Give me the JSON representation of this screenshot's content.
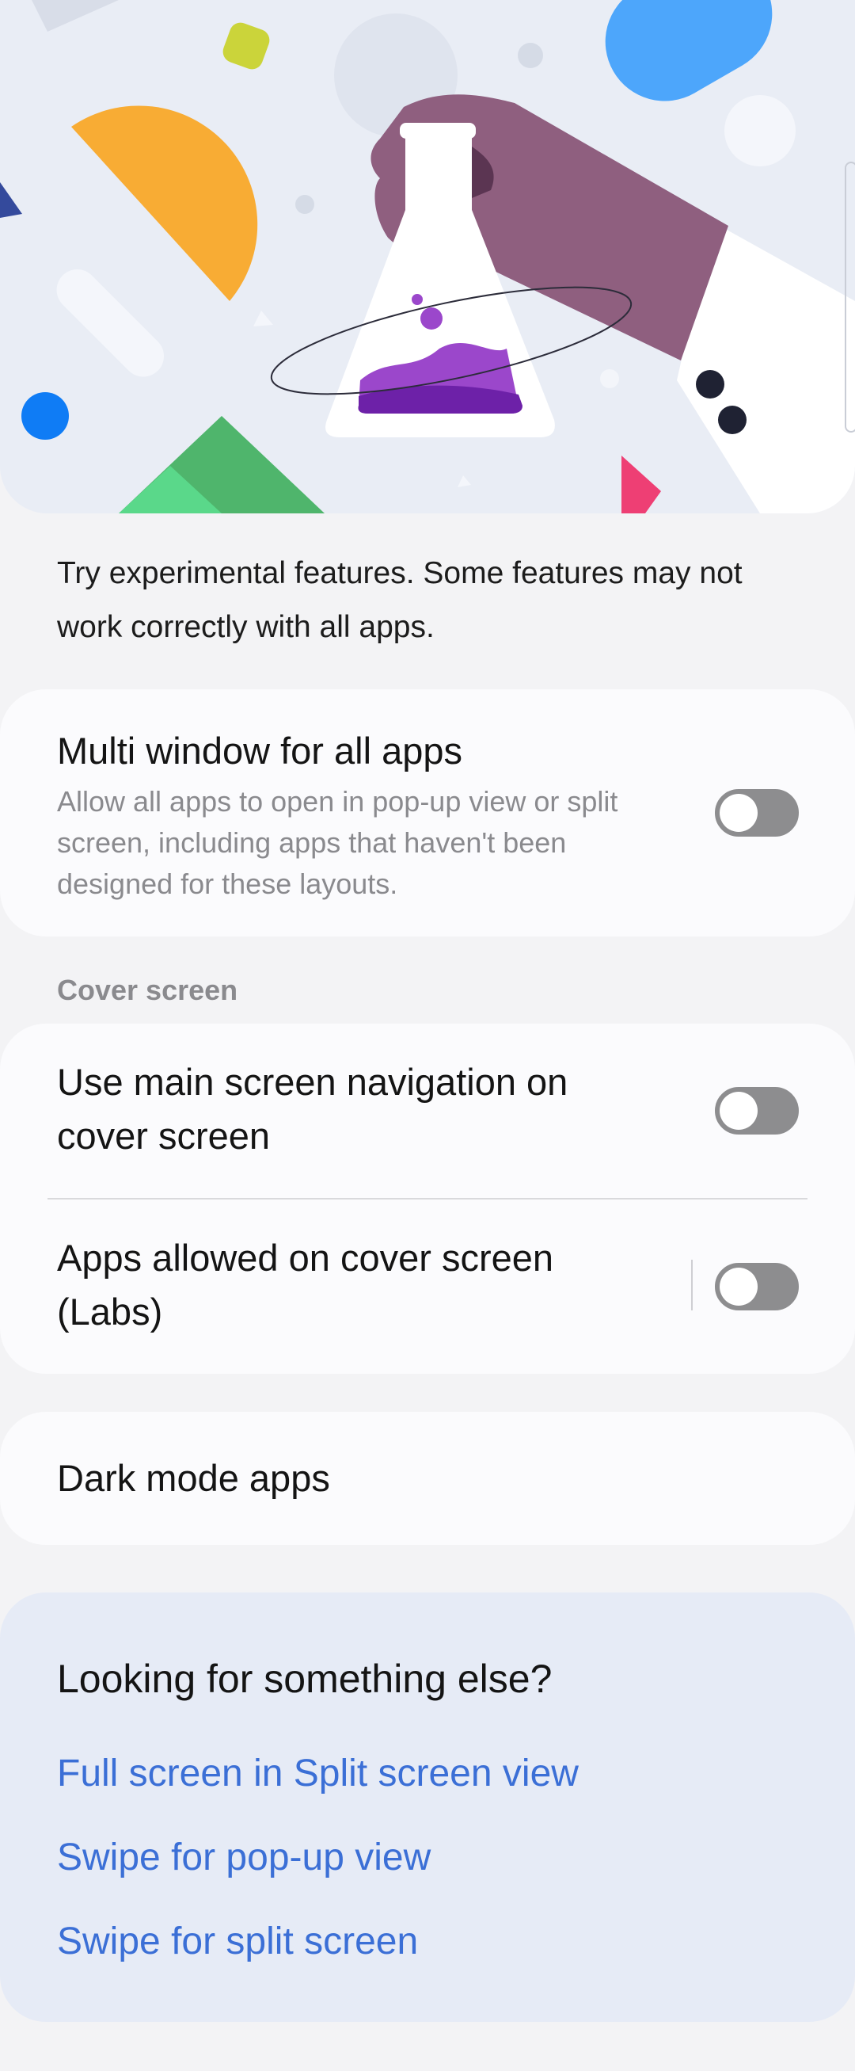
{
  "hero": {
    "illustration": "labs-flask-illustration"
  },
  "intro": {
    "text": "Try experimental features. Some features may not work correctly with all apps."
  },
  "multi_window": {
    "title": "Multi window for all apps",
    "subtitle": "Allow all apps to open in pop-up view or split screen, including apps that haven't been designed for these layouts.",
    "enabled": false
  },
  "cover_screen": {
    "section_label": "Cover screen",
    "navigation": {
      "title": "Use main screen navigation on cover screen",
      "enabled": false
    },
    "apps_allowed": {
      "title": "Apps allowed on cover screen (Labs)",
      "enabled": false
    }
  },
  "dark_mode": {
    "title": "Dark mode apps"
  },
  "suggestions": {
    "title": "Looking for something else?",
    "links": [
      "Full screen in Split screen view",
      "Swipe for pop-up view",
      "Swipe for split screen"
    ]
  },
  "colors": {
    "link": "#3b6fd6",
    "toggle_off": "#8d8d8f",
    "card": "#fbfbfd",
    "suggest_card": "#e6ebf6"
  }
}
